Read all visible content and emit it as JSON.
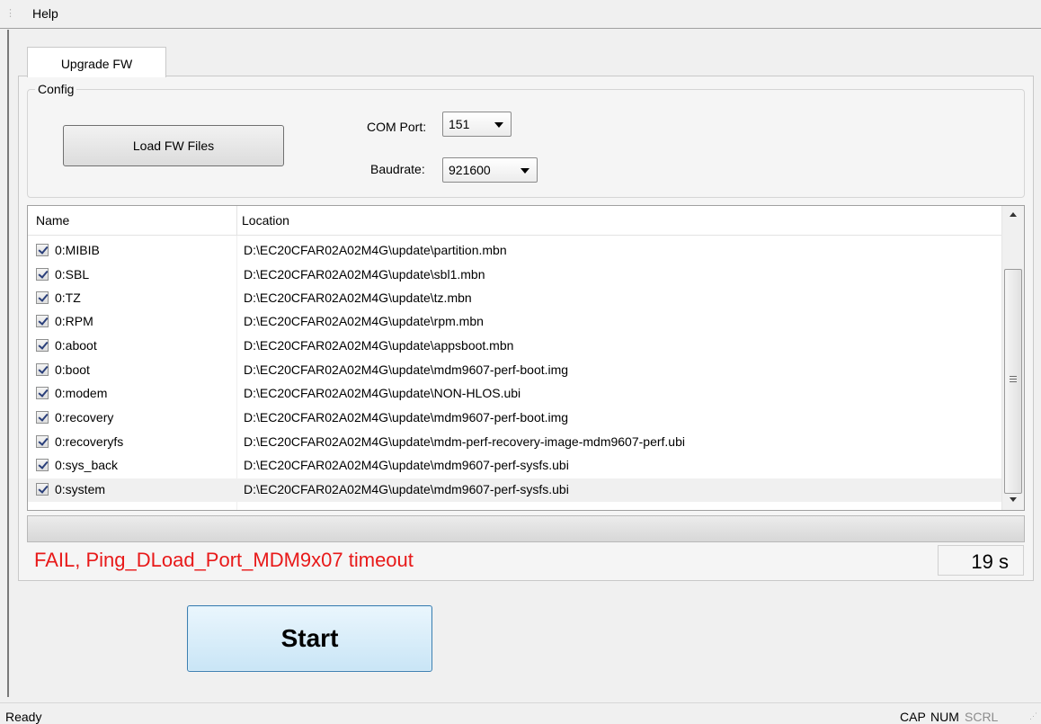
{
  "menu": {
    "help_label": "Help"
  },
  "tabs": [
    {
      "label": "Upgrade FW"
    }
  ],
  "config": {
    "group_label": "Config",
    "load_button_label": "Load FW Files",
    "com_port_label": "COM Port:",
    "com_port_value": "151",
    "baudrate_label": "Baudrate:",
    "baudrate_value": "921600"
  },
  "file_list": {
    "columns": {
      "name": "Name",
      "location": "Location"
    },
    "rows": [
      {
        "checked": true,
        "name": "0:MIBIB",
        "location": "D:\\EC20CFAR02A02M4G\\update\\partition.mbn"
      },
      {
        "checked": true,
        "name": "0:SBL",
        "location": "D:\\EC20CFAR02A02M4G\\update\\sbl1.mbn"
      },
      {
        "checked": true,
        "name": "0:TZ",
        "location": "D:\\EC20CFAR02A02M4G\\update\\tz.mbn"
      },
      {
        "checked": true,
        "name": "0:RPM",
        "location": "D:\\EC20CFAR02A02M4G\\update\\rpm.mbn"
      },
      {
        "checked": true,
        "name": "0:aboot",
        "location": "D:\\EC20CFAR02A02M4G\\update\\appsboot.mbn"
      },
      {
        "checked": true,
        "name": "0:boot",
        "location": "D:\\EC20CFAR02A02M4G\\update\\mdm9607-perf-boot.img"
      },
      {
        "checked": true,
        "name": "0:modem",
        "location": "D:\\EC20CFAR02A02M4G\\update\\NON-HLOS.ubi"
      },
      {
        "checked": true,
        "name": "0:recovery",
        "location": "D:\\EC20CFAR02A02M4G\\update\\mdm9607-perf-boot.img"
      },
      {
        "checked": true,
        "name": "0:recoveryfs",
        "location": "D:\\EC20CFAR02A02M4G\\update\\mdm-perf-recovery-image-mdm9607-perf.ubi"
      },
      {
        "checked": true,
        "name": "0:sys_back",
        "location": "D:\\EC20CFAR02A02M4G\\update\\mdm9607-perf-sysfs.ubi"
      },
      {
        "checked": true,
        "name": "0:system",
        "location": "D:\\EC20CFAR02A02M4G\\update\\mdm9607-perf-sysfs.ubi",
        "selected": true
      }
    ]
  },
  "progress": {
    "value": 0
  },
  "status": {
    "message": "FAIL, Ping_DLoad_Port_MDM9x07 timeout",
    "message_color": "#e81919",
    "elapsed": "19 s"
  },
  "start_button_label": "Start",
  "statusbar": {
    "ready": "Ready",
    "cap": "CAP",
    "num": "NUM",
    "scrl": "SCRL"
  }
}
